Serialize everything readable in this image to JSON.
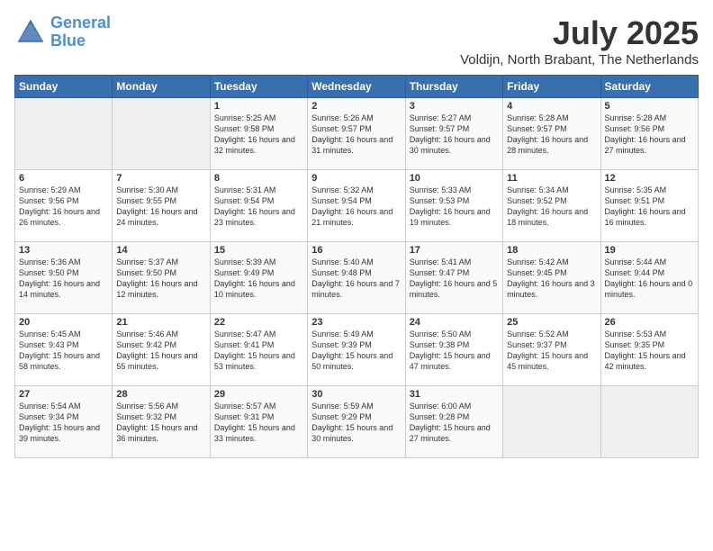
{
  "header": {
    "logo_line1": "General",
    "logo_line2": "Blue",
    "month": "July 2025",
    "location": "Voldijn, North Brabant, The Netherlands"
  },
  "weekdays": [
    "Sunday",
    "Monday",
    "Tuesday",
    "Wednesday",
    "Thursday",
    "Friday",
    "Saturday"
  ],
  "weeks": [
    [
      {
        "day": "",
        "sunrise": "",
        "sunset": "",
        "daylight": ""
      },
      {
        "day": "",
        "sunrise": "",
        "sunset": "",
        "daylight": ""
      },
      {
        "day": "1",
        "sunrise": "Sunrise: 5:25 AM",
        "sunset": "Sunset: 9:58 PM",
        "daylight": "Daylight: 16 hours and 32 minutes."
      },
      {
        "day": "2",
        "sunrise": "Sunrise: 5:26 AM",
        "sunset": "Sunset: 9:57 PM",
        "daylight": "Daylight: 16 hours and 31 minutes."
      },
      {
        "day": "3",
        "sunrise": "Sunrise: 5:27 AM",
        "sunset": "Sunset: 9:57 PM",
        "daylight": "Daylight: 16 hours and 30 minutes."
      },
      {
        "day": "4",
        "sunrise": "Sunrise: 5:28 AM",
        "sunset": "Sunset: 9:57 PM",
        "daylight": "Daylight: 16 hours and 28 minutes."
      },
      {
        "day": "5",
        "sunrise": "Sunrise: 5:28 AM",
        "sunset": "Sunset: 9:56 PM",
        "daylight": "Daylight: 16 hours and 27 minutes."
      }
    ],
    [
      {
        "day": "6",
        "sunrise": "Sunrise: 5:29 AM",
        "sunset": "Sunset: 9:56 PM",
        "daylight": "Daylight: 16 hours and 26 minutes."
      },
      {
        "day": "7",
        "sunrise": "Sunrise: 5:30 AM",
        "sunset": "Sunset: 9:55 PM",
        "daylight": "Daylight: 16 hours and 24 minutes."
      },
      {
        "day": "8",
        "sunrise": "Sunrise: 5:31 AM",
        "sunset": "Sunset: 9:54 PM",
        "daylight": "Daylight: 16 hours and 23 minutes."
      },
      {
        "day": "9",
        "sunrise": "Sunrise: 5:32 AM",
        "sunset": "Sunset: 9:54 PM",
        "daylight": "Daylight: 16 hours and 21 minutes."
      },
      {
        "day": "10",
        "sunrise": "Sunrise: 5:33 AM",
        "sunset": "Sunset: 9:53 PM",
        "daylight": "Daylight: 16 hours and 19 minutes."
      },
      {
        "day": "11",
        "sunrise": "Sunrise: 5:34 AM",
        "sunset": "Sunset: 9:52 PM",
        "daylight": "Daylight: 16 hours and 18 minutes."
      },
      {
        "day": "12",
        "sunrise": "Sunrise: 5:35 AM",
        "sunset": "Sunset: 9:51 PM",
        "daylight": "Daylight: 16 hours and 16 minutes."
      }
    ],
    [
      {
        "day": "13",
        "sunrise": "Sunrise: 5:36 AM",
        "sunset": "Sunset: 9:50 PM",
        "daylight": "Daylight: 16 hours and 14 minutes."
      },
      {
        "day": "14",
        "sunrise": "Sunrise: 5:37 AM",
        "sunset": "Sunset: 9:50 PM",
        "daylight": "Daylight: 16 hours and 12 minutes."
      },
      {
        "day": "15",
        "sunrise": "Sunrise: 5:39 AM",
        "sunset": "Sunset: 9:49 PM",
        "daylight": "Daylight: 16 hours and 10 minutes."
      },
      {
        "day": "16",
        "sunrise": "Sunrise: 5:40 AM",
        "sunset": "Sunset: 9:48 PM",
        "daylight": "Daylight: 16 hours and 7 minutes."
      },
      {
        "day": "17",
        "sunrise": "Sunrise: 5:41 AM",
        "sunset": "Sunset: 9:47 PM",
        "daylight": "Daylight: 16 hours and 5 minutes."
      },
      {
        "day": "18",
        "sunrise": "Sunrise: 5:42 AM",
        "sunset": "Sunset: 9:45 PM",
        "daylight": "Daylight: 16 hours and 3 minutes."
      },
      {
        "day": "19",
        "sunrise": "Sunrise: 5:44 AM",
        "sunset": "Sunset: 9:44 PM",
        "daylight": "Daylight: 16 hours and 0 minutes."
      }
    ],
    [
      {
        "day": "20",
        "sunrise": "Sunrise: 5:45 AM",
        "sunset": "Sunset: 9:43 PM",
        "daylight": "Daylight: 15 hours and 58 minutes."
      },
      {
        "day": "21",
        "sunrise": "Sunrise: 5:46 AM",
        "sunset": "Sunset: 9:42 PM",
        "daylight": "Daylight: 15 hours and 55 minutes."
      },
      {
        "day": "22",
        "sunrise": "Sunrise: 5:47 AM",
        "sunset": "Sunset: 9:41 PM",
        "daylight": "Daylight: 15 hours and 53 minutes."
      },
      {
        "day": "23",
        "sunrise": "Sunrise: 5:49 AM",
        "sunset": "Sunset: 9:39 PM",
        "daylight": "Daylight: 15 hours and 50 minutes."
      },
      {
        "day": "24",
        "sunrise": "Sunrise: 5:50 AM",
        "sunset": "Sunset: 9:38 PM",
        "daylight": "Daylight: 15 hours and 47 minutes."
      },
      {
        "day": "25",
        "sunrise": "Sunrise: 5:52 AM",
        "sunset": "Sunset: 9:37 PM",
        "daylight": "Daylight: 15 hours and 45 minutes."
      },
      {
        "day": "26",
        "sunrise": "Sunrise: 5:53 AM",
        "sunset": "Sunset: 9:35 PM",
        "daylight": "Daylight: 15 hours and 42 minutes."
      }
    ],
    [
      {
        "day": "27",
        "sunrise": "Sunrise: 5:54 AM",
        "sunset": "Sunset: 9:34 PM",
        "daylight": "Daylight: 15 hours and 39 minutes."
      },
      {
        "day": "28",
        "sunrise": "Sunrise: 5:56 AM",
        "sunset": "Sunset: 9:32 PM",
        "daylight": "Daylight: 15 hours and 36 minutes."
      },
      {
        "day": "29",
        "sunrise": "Sunrise: 5:57 AM",
        "sunset": "Sunset: 9:31 PM",
        "daylight": "Daylight: 15 hours and 33 minutes."
      },
      {
        "day": "30",
        "sunrise": "Sunrise: 5:59 AM",
        "sunset": "Sunset: 9:29 PM",
        "daylight": "Daylight: 15 hours and 30 minutes."
      },
      {
        "day": "31",
        "sunrise": "Sunrise: 6:00 AM",
        "sunset": "Sunset: 9:28 PM",
        "daylight": "Daylight: 15 hours and 27 minutes."
      },
      {
        "day": "",
        "sunrise": "",
        "sunset": "",
        "daylight": ""
      },
      {
        "day": "",
        "sunrise": "",
        "sunset": "",
        "daylight": ""
      }
    ]
  ]
}
